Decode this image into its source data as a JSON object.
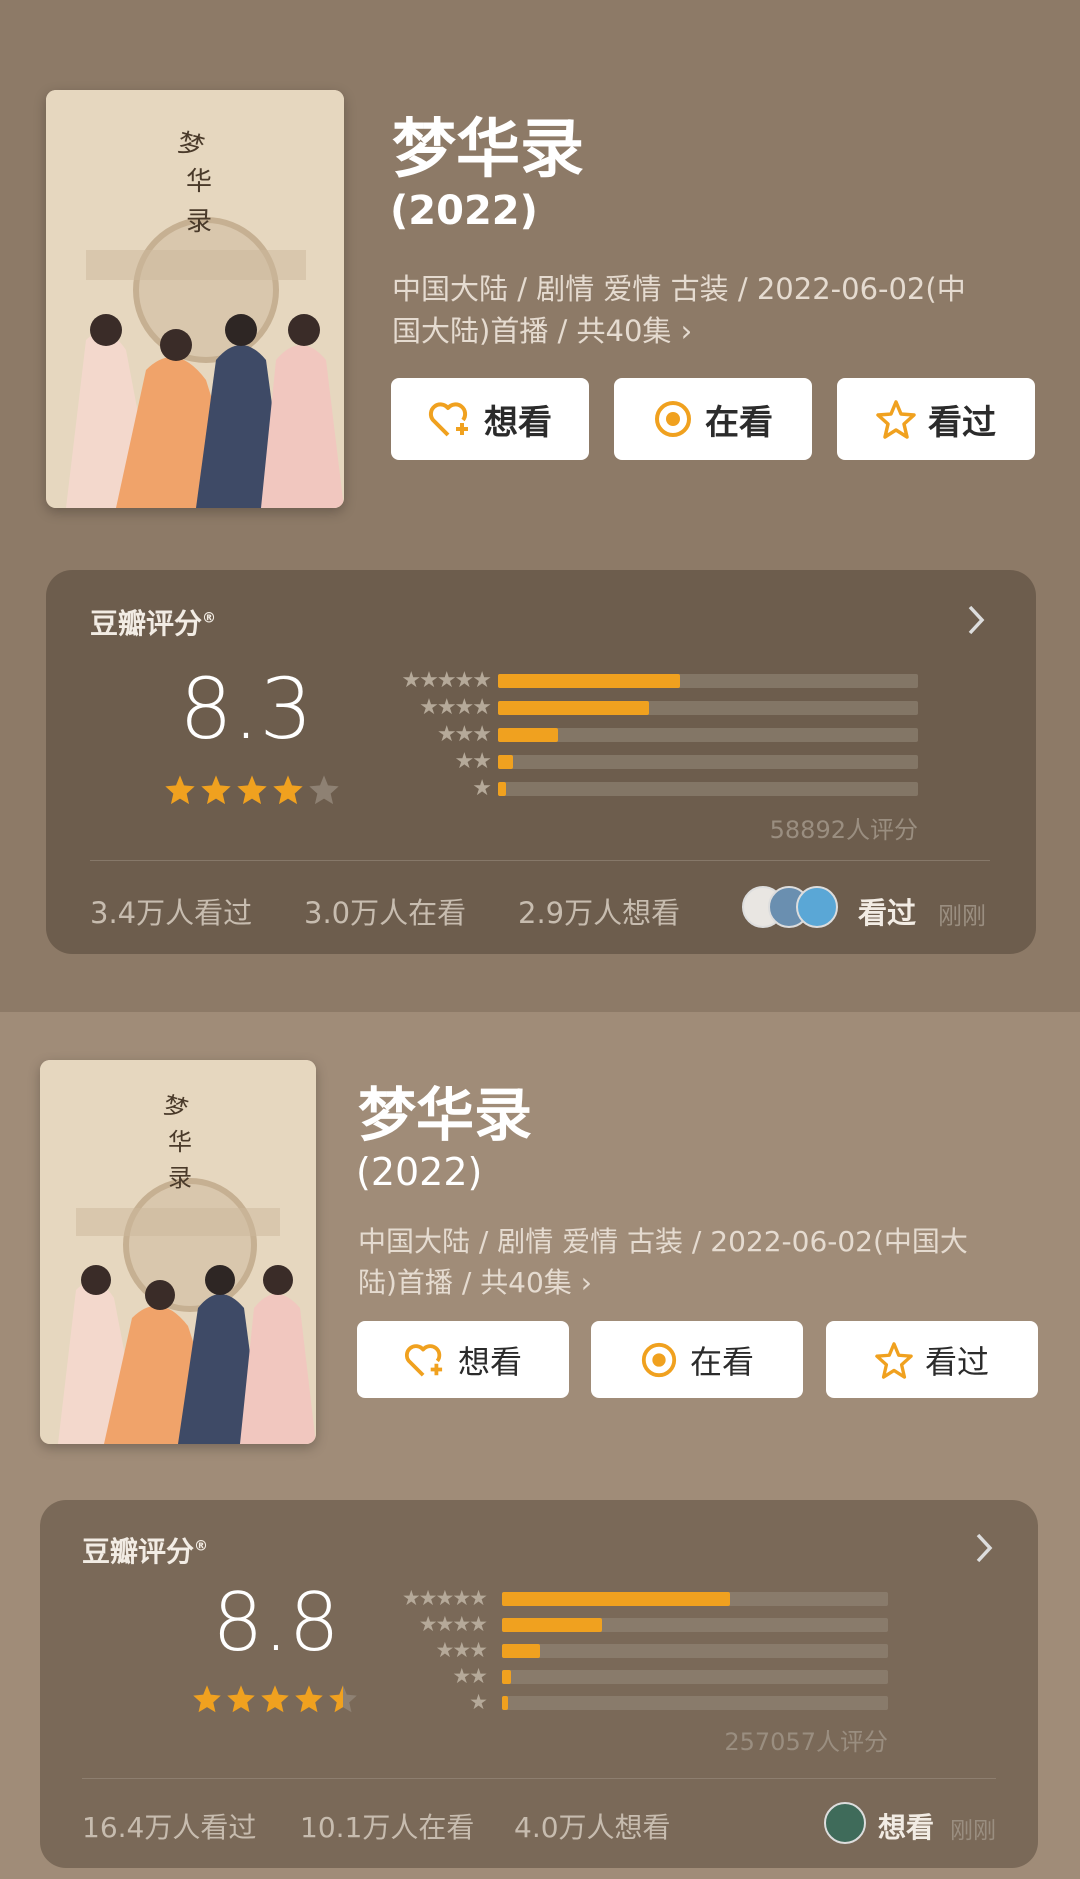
{
  "sections": [
    {
      "title": "梦华录",
      "year": "(2022)",
      "meta_line1": "中国大陆 / 剧情 爱情 古装 / 2022-06-02(中",
      "meta_line2": "国大陆)首播 / 共40集 ›",
      "buttons": {
        "want": "想看",
        "watching": "在看",
        "watched": "看过"
      },
      "rating_title": "豆瓣评分",
      "registered": "®",
      "score": "8.3",
      "star_fraction": 0.83,
      "distribution_percent": [
        43.3,
        36.0,
        14.4,
        3.5,
        2.0
      ],
      "rating_count": "58892人评分",
      "stats": {
        "watched": "3.4万人看过",
        "watching": "3.0万人在看",
        "want": "2.9万人想看"
      },
      "activity": "看过",
      "time_ago": "刚刚"
    },
    {
      "title": "梦华录",
      "year": "(2022)",
      "meta_line1": "中国大陆 / 剧情 爱情 古装 / 2022-06-02(中国大",
      "meta_line2": "陆)首播 / 共40集 ›",
      "buttons": {
        "want": "想看",
        "watching": "在看",
        "watched": "看过"
      },
      "rating_title": "豆瓣评分",
      "registered": "®",
      "score": "8.8",
      "star_fraction": 0.88,
      "distribution_percent": [
        59.0,
        26.0,
        9.8,
        2.4,
        1.6
      ],
      "rating_count": "257057人评分",
      "stats": {
        "watched": "16.4万人看过",
        "watching": "10.1万人在看",
        "want": "4.0万人想看"
      },
      "activity": "想看",
      "time_ago": "刚刚"
    }
  ],
  "colors": {
    "accent": "#f0a11f",
    "card_bg": "#5a4c3e",
    "section1_bg": "#8d7a67",
    "section2_bg": "#a08c78"
  },
  "icons": {
    "want": "heart-plus-icon",
    "watching": "target-circle-icon",
    "watched": "star-outline-icon",
    "chevron": "chevron-right-icon"
  }
}
